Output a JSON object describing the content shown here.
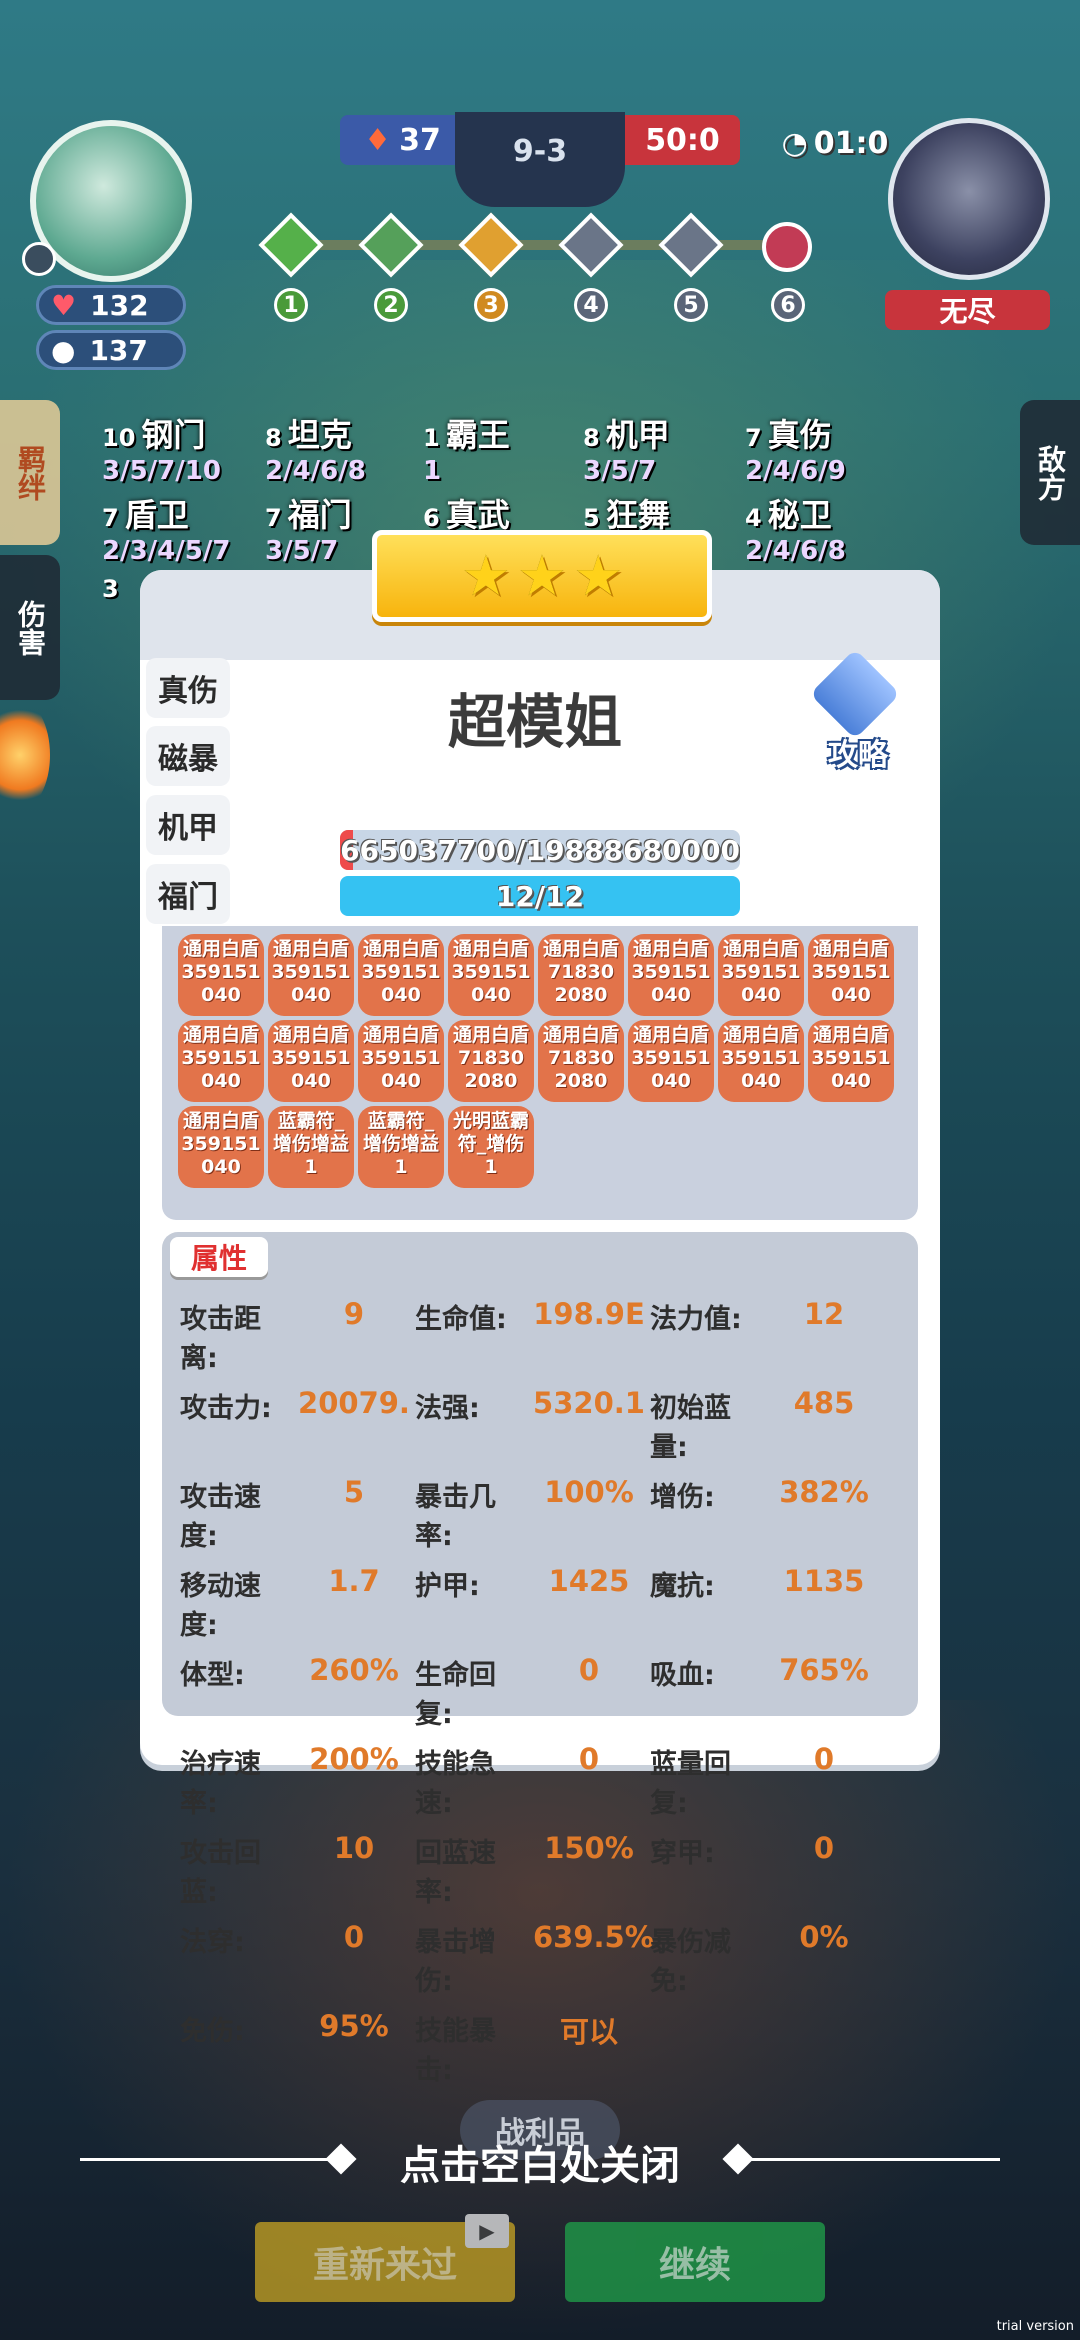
{
  "hud": {
    "player_hp": "132",
    "player_gold": "137",
    "left_score": "37",
    "stage": "9-3",
    "right_score": "50:0",
    "timer": "01:0",
    "enemy_label": "无尽",
    "wave_nodes": [
      "1",
      "2",
      "3",
      "4",
      "5",
      "6"
    ]
  },
  "side_tabs": {
    "synergy": "羁绊",
    "damage": "伤害",
    "enemy": "敌方"
  },
  "synergies": [
    {
      "num": "10",
      "name": "钢门",
      "tiers": "3/5/7/10"
    },
    {
      "num": "8",
      "name": "坦克",
      "tiers": "2/4/6/8"
    },
    {
      "num": "1",
      "name": "霸王",
      "tiers": "1"
    },
    {
      "num": "8",
      "name": "机甲",
      "tiers": "3/5/7"
    },
    {
      "num": "7",
      "name": "真伤",
      "tiers": "2/4/6/9"
    },
    {
      "num": "7",
      "name": "盾卫",
      "tiers": "2/3/4/5/7"
    },
    {
      "num": "7",
      "name": "福门",
      "tiers": "3/5/7"
    },
    {
      "num": "6",
      "name": "真武",
      "tiers": ""
    },
    {
      "num": "5",
      "name": "狂舞",
      "tiers": ""
    },
    {
      "num": "4",
      "name": "秘卫",
      "tiers": "2/4/6/8"
    },
    {
      "num": "3",
      "name": "",
      "tiers": ""
    }
  ],
  "modal": {
    "hero_name": "超模姐",
    "guide_label": "攻略",
    "tabs": [
      "真伤",
      "磁暴",
      "机甲",
      "福门"
    ],
    "hp_text": "665037700/19888680000",
    "hp_fraction": 0.0334,
    "mana_text": "12/12",
    "items": [
      [
        "通用白盾",
        "359151",
        "040"
      ],
      [
        "通用白盾",
        "359151",
        "040"
      ],
      [
        "通用白盾",
        "359151",
        "040"
      ],
      [
        "通用白盾",
        "359151",
        "040"
      ],
      [
        "通用白盾",
        "71830",
        "2080"
      ],
      [
        "通用白盾",
        "359151",
        "040"
      ],
      [
        "通用白盾",
        "359151",
        "040"
      ],
      [
        "通用白盾",
        "359151",
        "040"
      ],
      [
        "通用白盾",
        "359151",
        "040"
      ],
      [
        "通用白盾",
        "359151",
        "040"
      ],
      [
        "通用白盾",
        "359151",
        "040"
      ],
      [
        "通用白盾",
        "71830",
        "2080"
      ],
      [
        "通用白盾",
        "71830",
        "2080"
      ],
      [
        "通用白盾",
        "359151",
        "040"
      ],
      [
        "通用白盾",
        "359151",
        "040"
      ],
      [
        "通用白盾",
        "359151",
        "040"
      ],
      [
        "通用白盾",
        "359151",
        "040"
      ],
      [
        "蓝霸符_",
        "增伤增益",
        "1"
      ],
      [
        "蓝霸符_",
        "增伤增益",
        "1"
      ],
      [
        "光明蓝霸",
        "符_增伤",
        "1"
      ]
    ],
    "attr_title": "属性",
    "attributes": [
      {
        "label": "攻击距离:",
        "value": "9"
      },
      {
        "label": "生命值:",
        "value": "198.9E"
      },
      {
        "label": "法力值:",
        "value": "12"
      },
      {
        "label": "攻击力:",
        "value": "20079."
      },
      {
        "label": "法强:",
        "value": "5320.1"
      },
      {
        "label": "初始蓝量:",
        "value": "485"
      },
      {
        "label": "攻击速度:",
        "value": "5"
      },
      {
        "label": "暴击几率:",
        "value": "100%"
      },
      {
        "label": "增伤:",
        "value": "382%"
      },
      {
        "label": "移动速度:",
        "value": "1.7"
      },
      {
        "label": "护甲:",
        "value": "1425"
      },
      {
        "label": "魔抗:",
        "value": "1135"
      },
      {
        "label": "体型:",
        "value": "260%"
      },
      {
        "label": "生命回复:",
        "value": "0"
      },
      {
        "label": "吸血:",
        "value": "765%"
      },
      {
        "label": "治疗速率:",
        "value": "200%"
      },
      {
        "label": "技能急速:",
        "value": "0"
      },
      {
        "label": "蓝量回复:",
        "value": "0"
      },
      {
        "label": "攻击回蓝:",
        "value": "10"
      },
      {
        "label": "回蓝速率:",
        "value": "150%"
      },
      {
        "label": "穿甲:",
        "value": "0"
      },
      {
        "label": "法穿:",
        "value": "0"
      },
      {
        "label": "暴击增伤:",
        "value": "639.5%"
      },
      {
        "label": "暴伤减免:",
        "value": "0%"
      },
      {
        "label": "免伤:",
        "value": "95%"
      },
      {
        "label": "技能暴击:",
        "value": "可以"
      }
    ]
  },
  "bottom": {
    "behind_label": "战利品",
    "close_hint": "点击空白处关闭",
    "retry_label": "重新来过",
    "continue_label": "继续",
    "watermark": "trial version"
  },
  "colors": {
    "item_bg": "#e2734a",
    "value_orange": "#e07a2a",
    "retry_yellow": "#c9a523",
    "continue_green": "#1f9a48"
  }
}
